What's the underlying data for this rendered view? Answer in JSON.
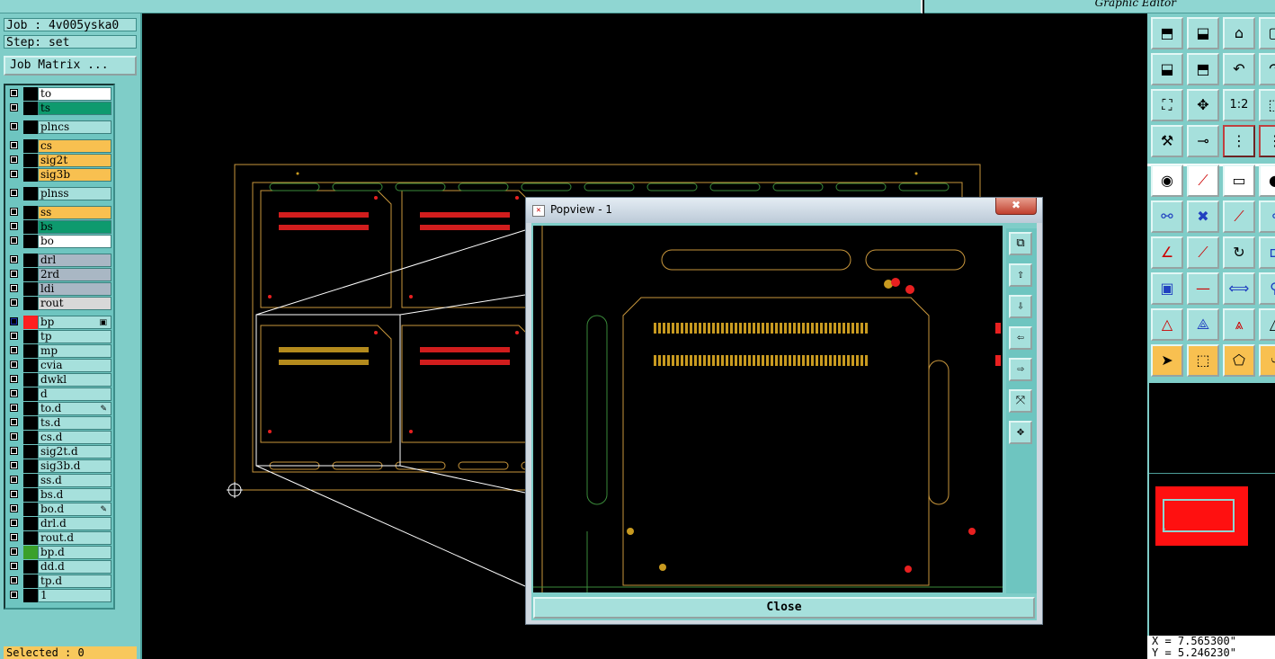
{
  "window": {
    "right_title": "Graphic Editor"
  },
  "job": {
    "job_label": "Job : 4v005yska0",
    "step_label": "Step: set"
  },
  "job_matrix_button": "Job Matrix ...",
  "layers": [
    {
      "name": "to",
      "color": "#ffffff",
      "swatch": "#000000"
    },
    {
      "name": "ts",
      "color": "#0e9a6e",
      "swatch": "#000000"
    },
    {
      "name": "plncs",
      "color": "#a6e0dc",
      "swatch": "#000000",
      "gap": true
    },
    {
      "name": "cs",
      "color": "#f8c050",
      "swatch": "#000000",
      "gap": true
    },
    {
      "name": "sig2t",
      "color": "#f8c050",
      "swatch": "#000000"
    },
    {
      "name": "sig3b",
      "color": "#f8c050",
      "swatch": "#000000"
    },
    {
      "name": "plnss",
      "color": "#a6e0dc",
      "swatch": "#000000",
      "gap": true
    },
    {
      "name": "ss",
      "color": "#f8c050",
      "swatch": "#000000",
      "gap": true
    },
    {
      "name": "bs",
      "color": "#0e9a6e",
      "swatch": "#000000"
    },
    {
      "name": "bo",
      "color": "#ffffff",
      "swatch": "#000000"
    },
    {
      "name": "drl",
      "color": "#a9b7c4",
      "swatch": "#000000",
      "gap": true
    },
    {
      "name": "2rd",
      "color": "#a9b7c4",
      "swatch": "#000000"
    },
    {
      "name": "ldi",
      "color": "#a9b7c4",
      "swatch": "#000000"
    },
    {
      "name": "rout",
      "color": "#d8d8d8",
      "swatch": "#000000"
    },
    {
      "name": "bp",
      "color": "#a6e0dc",
      "swatch": "#ff2020",
      "mark": "▣",
      "gap": true,
      "active": true
    },
    {
      "name": "tp",
      "color": "#a6e0dc",
      "swatch": "#000000"
    },
    {
      "name": "mp",
      "color": "#a6e0dc",
      "swatch": "#000000"
    },
    {
      "name": "cvia",
      "color": "#a6e0dc",
      "swatch": "#000000"
    },
    {
      "name": "dwkl",
      "color": "#a6e0dc",
      "swatch": "#000000"
    },
    {
      "name": "d",
      "color": "#a6e0dc",
      "swatch": "#000000"
    },
    {
      "name": "to.d",
      "color": "#a6e0dc",
      "swatch": "#000000",
      "mark": "✎"
    },
    {
      "name": "ts.d",
      "color": "#a6e0dc",
      "swatch": "#000000"
    },
    {
      "name": "cs.d",
      "color": "#a6e0dc",
      "swatch": "#000000"
    },
    {
      "name": "sig2t.d",
      "color": "#a6e0dc",
      "swatch": "#000000"
    },
    {
      "name": "sig3b.d",
      "color": "#a6e0dc",
      "swatch": "#000000"
    },
    {
      "name": "ss.d",
      "color": "#a6e0dc",
      "swatch": "#000000"
    },
    {
      "name": "bs.d",
      "color": "#a6e0dc",
      "swatch": "#000000"
    },
    {
      "name": "bo.d",
      "color": "#a6e0dc",
      "swatch": "#000000",
      "mark": "✎"
    },
    {
      "name": "drl.d",
      "color": "#a6e0dc",
      "swatch": "#000000"
    },
    {
      "name": "rout.d",
      "color": "#a6e0dc",
      "swatch": "#000000"
    },
    {
      "name": "bp.d",
      "color": "#a6e0dc",
      "swatch": "#3aa02a"
    },
    {
      "name": "dd.d",
      "color": "#a6e0dc",
      "swatch": "#000000"
    },
    {
      "name": "tp.d",
      "color": "#a6e0dc",
      "swatch": "#000000"
    },
    {
      "name": "1",
      "color": "#a6e0dc",
      "swatch": "#000000"
    }
  ],
  "status": {
    "selected": "Selected : 0"
  },
  "popview": {
    "title": "Popview - 1",
    "close_x": "✖",
    "close_button": "Close"
  },
  "coords": {
    "x": "X = 7.565300\"",
    "y": "Y = 5.246230\""
  },
  "colors": {
    "outline": "#c8963c",
    "copper": "#e82020",
    "gold": "#c89a20",
    "rout": "#3a8a3a",
    "panel": "#7fcdc8"
  }
}
